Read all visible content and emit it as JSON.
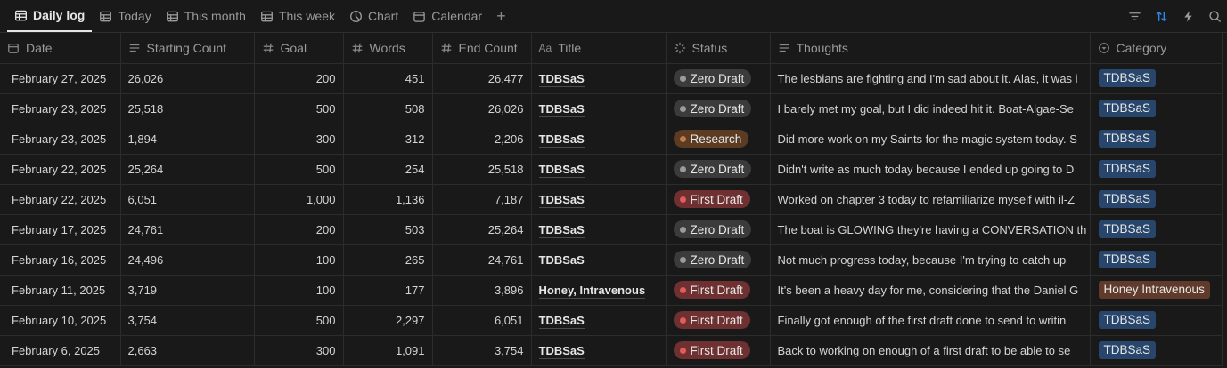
{
  "views": [
    {
      "label": "Daily log",
      "icon": "table-icon",
      "active": true
    },
    {
      "label": "Today",
      "icon": "table-icon",
      "active": false
    },
    {
      "label": "This month",
      "icon": "table-icon",
      "active": false
    },
    {
      "label": "This week",
      "icon": "table-icon",
      "active": false
    },
    {
      "label": "Chart",
      "icon": "chart-icon",
      "active": false
    },
    {
      "label": "Calendar",
      "icon": "calendar-icon",
      "active": false
    }
  ],
  "add_view_symbol": "+",
  "tools": [
    "filter-icon",
    "sort-icon",
    "automation-icon",
    "search-icon"
  ],
  "columns": {
    "date": "Date",
    "starting": "Starting Count",
    "goal": "Goal",
    "words": "Words",
    "end": "End Count",
    "title": "Title",
    "status": "Status",
    "thoughts": "Thoughts",
    "category": "Category"
  },
  "column_title_prefix": "Aa",
  "status_colors": {
    "Zero Draft": {
      "bg": "#3b3b3b",
      "dot": "#9b9b9b"
    },
    "Research": {
      "bg": "#5c3b23",
      "dot": "#c47a44"
    },
    "First Draft": {
      "bg": "#6e3030",
      "dot": "#e35b5b"
    }
  },
  "category_colors": {
    "TDBSaS": "#28456c",
    "Honey Intravenous": "#603b2c"
  },
  "rows": [
    {
      "date": "February 27, 2025",
      "starting": "26,026",
      "goal": "200",
      "words": "451",
      "end": "26,477",
      "title": "TDBSaS",
      "status": "Zero Draft",
      "thoughts": "The lesbians are fighting and I'm sad about it. Alas, it was i",
      "category": "TDBSaS"
    },
    {
      "date": "February 23, 2025",
      "starting": "25,518",
      "goal": "500",
      "words": "508",
      "end": "26,026",
      "title": "TDBSaS",
      "status": "Zero Draft",
      "thoughts": "I barely met my goal, but I did indeed hit it. Boat-Algae-Se",
      "category": "TDBSaS"
    },
    {
      "date": "February 23, 2025",
      "starting": "1,894",
      "goal": "300",
      "words": "312",
      "end": "2,206",
      "title": "TDBSaS",
      "status": "Research",
      "thoughts": "Did more work on my Saints for the magic system today. S",
      "category": "TDBSaS"
    },
    {
      "date": "February 22, 2025",
      "starting": "25,264",
      "goal": "500",
      "words": "254",
      "end": "25,518",
      "title": "TDBSaS",
      "status": "Zero Draft",
      "thoughts": "Didn't write as much today because I ended up going to D",
      "category": "TDBSaS"
    },
    {
      "date": "February 22, 2025",
      "starting": "6,051",
      "goal": "1,000",
      "words": "1,136",
      "end": "7,187",
      "title": "TDBSaS",
      "status": "First Draft",
      "thoughts": "Worked on chapter 3 today to refamiliarize myself with il-Z",
      "category": "TDBSaS"
    },
    {
      "date": "February 17, 2025",
      "starting": "24,761",
      "goal": "200",
      "words": "503",
      "end": "25,264",
      "title": "TDBSaS",
      "status": "Zero Draft",
      "thoughts": "The boat is GLOWING they're having a CONVERSATION th",
      "category": "TDBSaS"
    },
    {
      "date": "February 16, 2025",
      "starting": "24,496",
      "goal": "100",
      "words": "265",
      "end": "24,761",
      "title": "TDBSaS",
      "status": "Zero Draft",
      "thoughts": "Not much progress today, because I'm trying to catch up",
      "category": "TDBSaS"
    },
    {
      "date": "February 11, 2025",
      "starting": "3,719",
      "goal": "100",
      "words": "177",
      "end": "3,896",
      "title": "Honey, Intravenous",
      "status": "First Draft",
      "thoughts": "It's been a heavy day for me, considering that the Daniel G",
      "category": "Honey Intravenous"
    },
    {
      "date": "February 10, 2025",
      "starting": "3,754",
      "goal": "500",
      "words": "2,297",
      "end": "6,051",
      "title": "TDBSaS",
      "status": "First Draft",
      "thoughts": "Finally got enough of the first draft done to send to writin",
      "category": "TDBSaS"
    },
    {
      "date": "February 6, 2025",
      "starting": "2,663",
      "goal": "300",
      "words": "1,091",
      "end": "3,754",
      "title": "TDBSaS",
      "status": "First Draft",
      "thoughts": "Back to working on enough of a first draft to be able to se",
      "category": "TDBSaS"
    }
  ]
}
